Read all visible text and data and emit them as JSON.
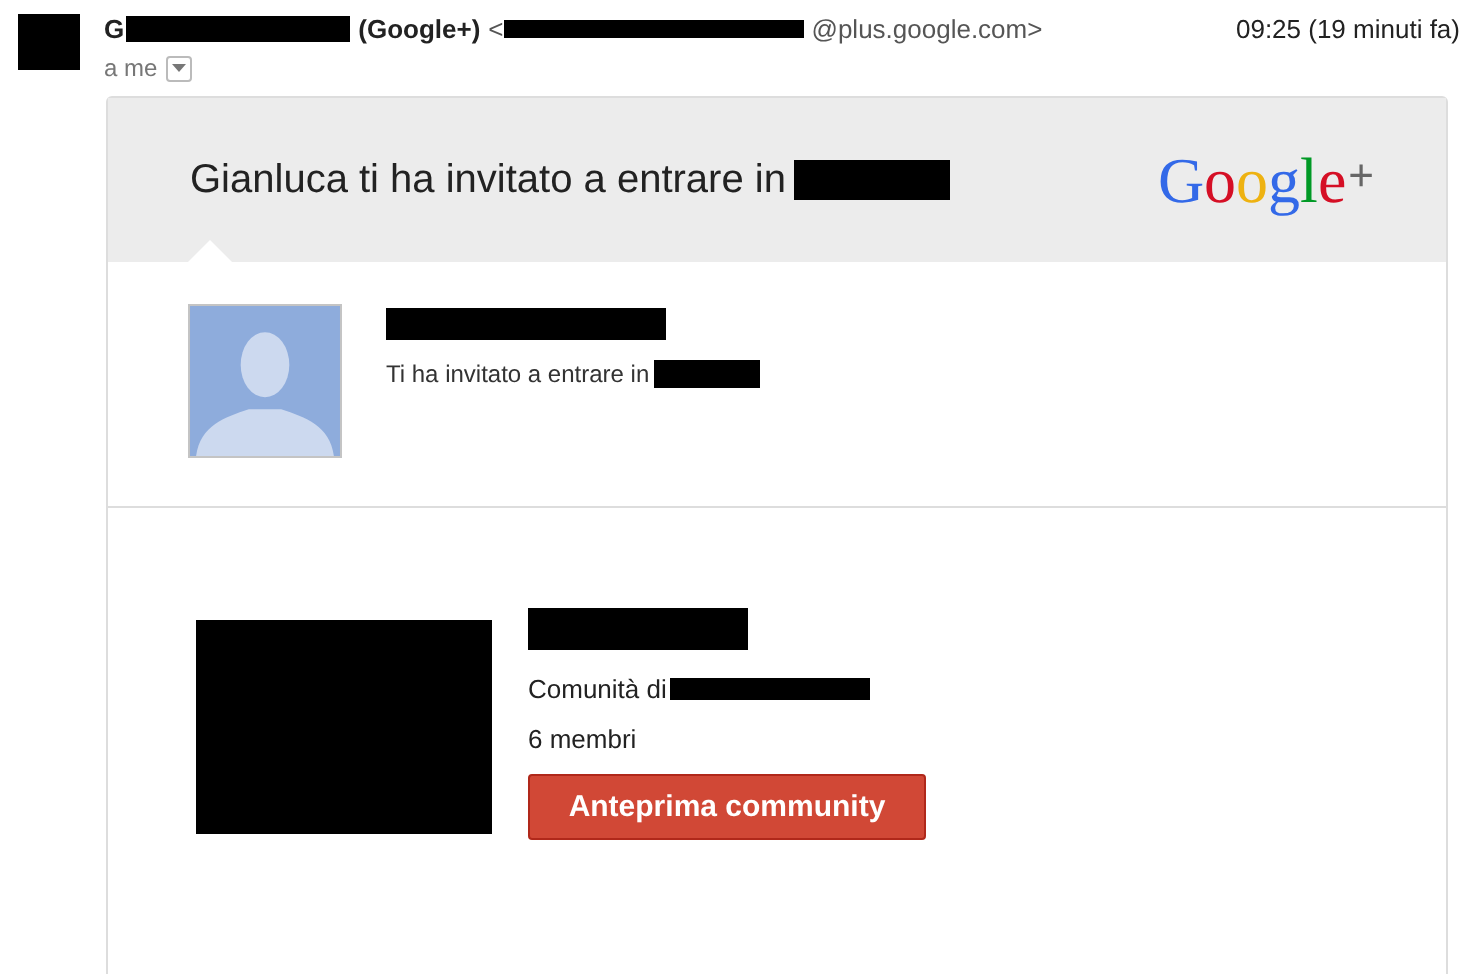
{
  "email": {
    "sender_initial": "G",
    "sender_tag": "(Google+)",
    "address_open": "<",
    "address_domain": "@plus.google.com>",
    "time": "09:25 (19 minuti fa)",
    "recipient": "a me"
  },
  "card": {
    "title": "Gianluca ti ha invitato a entrare in",
    "logo": {
      "word": "Google",
      "plus": "+"
    },
    "inviter": {
      "message": "Ti ha invitato a entrare in"
    },
    "community": {
      "owner_label": "Comunità di",
      "members": "6 membri",
      "button": "Anteprima community"
    }
  }
}
